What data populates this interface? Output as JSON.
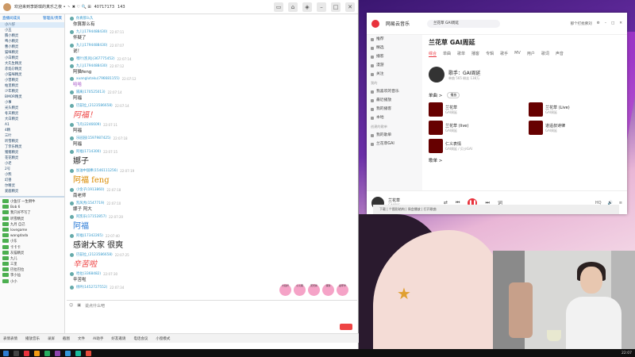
{
  "chat": {
    "title_bar": "欢迎来到李斯琪的真乐之夜 • 丶 ✖ ♡ 🔍 ⊞",
    "stat1": "40717173",
    "stat2": "143",
    "left_panel": {
      "title": "直播间成员",
      "right": "管理员/贵宾",
      "items": [
        "小八仔",
        "小五",
        "腾小精灵",
        "啤小精灵",
        "曹小精灵",
        "猫咪精灵",
        "小白精灵",
        "大先生精灵",
        "赤焰尕精灵",
        "小猫咪精灵",
        "小曾精灵",
        "帕里精灵",
        "少年精灵",
        "BMOR精灵",
        "小事",
        "光头精灵",
        "冬天精灵",
        "大白精灵",
        "A1",
        "4精",
        "三叶",
        "听雪精灵",
        "丁李乐精灵",
        "猪猪精灵",
        "花花精灵",
        "小老",
        "2号",
        "小熊",
        "幻兽",
        "尔精灵",
        "爱鹿精灵"
      ],
      "members": [
        "小鱼仔 一生倒牛",
        "Bob 6",
        "我只好不写了",
        "听雪精灵",
        "九月 自己",
        "lovegame",
        "wangdada",
        "小东",
        "卡卡卡",
        "灰猫精灵",
        "九儿",
        "三里",
        "巴拉巴拉",
        "李小仙",
        "小小"
      ]
    },
    "messages": [
      {
        "name": "你真那么久",
        "time": "",
        "text": "你算那么有",
        "cls": ""
      },
      {
        "name": "九儿(1794488430)",
        "time": "22:07:11",
        "text": "怀疑了",
        "cls": ""
      },
      {
        "name": "九儿(1794488430)",
        "time": "22:07:07",
        "text": "说！",
        "cls": ""
      },
      {
        "name": "嘿叶(凯风)(367775452)",
        "time": "22:07:14",
        "text": "",
        "cls": ""
      },
      {
        "name": "九儿(1794488430)",
        "time": "22:07:12",
        "text": "阿猫feng",
        "cls": ""
      },
      {
        "name": "xuanglutaku(796681155)",
        "time": "22:07:12",
        "text": "哈哈",
        "cls": "pur"
      },
      {
        "name": "隔离(170525013)",
        "time": "22:07:14",
        "text": "阿福",
        "cls": ""
      },
      {
        "name": "巴兹拉_(2123586658)",
        "time": "22:07:14",
        "text": "阿福！",
        "cls": "big red"
      },
      {
        "name": "飞鸟(2246609)",
        "time": "22:07:11",
        "text": "阿福",
        "cls": ""
      },
      {
        "name": "乐园园(1597987425)",
        "time": "22:07:18",
        "text": "阿福",
        "cls": ""
      },
      {
        "name": "阿福(1714300)",
        "time": "22:07:15",
        "text": "娜子",
        "cls": "big"
      },
      {
        "name": "加油中国棒(1546111256)",
        "time": "22:07:19",
        "text": "阿福 feng",
        "cls": "big org"
      },
      {
        "name": "小金子(1913860)",
        "time": "22:07:18",
        "text": "南老师",
        "cls": ""
      },
      {
        "name": "凯风秀(1547719)",
        "time": "22:07:10",
        "text": "娜子 阿大",
        "cls": ""
      },
      {
        "name": "阿凯乐(17152857)",
        "time": "22:07:20",
        "text": "阿福",
        "cls": "big blu"
      },
      {
        "name": "阿福(17342265)",
        "time": "22:07:40",
        "text": "感谢大家   很爽",
        "cls": "big"
      },
      {
        "name": "巴兹拉_(2123586658)",
        "time": "22:07:25",
        "text": "辛苦啦",
        "cls": "big red"
      },
      {
        "name": "哈拉(3368482)",
        "time": "22:07:30",
        "text": "辛苦啦",
        "cls": ""
      },
      {
        "name": "杨吟(1452727552)",
        "time": "22:07:34",
        "text": "",
        "cls": ""
      }
    ],
    "gifts": [
      "大拉杆",
      "小火箭",
      "荧光棒",
      "辣条",
      "嘉年华"
    ],
    "input_placeholder": "说点什么吧",
    "bottom": [
      "表情表情",
      "播放音乐",
      "录屏",
      "截图",
      "文件",
      "AI助手",
      "好友邀请",
      "电话会议",
      "小窗模式"
    ]
  },
  "music": {
    "brand": "网易云音乐",
    "search": "兰花草 GAI周延",
    "user": "那个打扰佛刘",
    "sidebar": [
      "推荐",
      "精选",
      "播客",
      "漫游",
      "关注",
      "我的",
      "我喜欢的音乐",
      "最近播放",
      "我的播客",
      "本地",
      "创建的歌单",
      "我的歌单",
      "兰花草GAI"
    ],
    "page_title": "兰花草 GAI周延",
    "tabs": [
      "综合",
      "单曲",
      "歌单",
      "播客",
      "专辑",
      "歌手",
      "MV",
      "用户",
      "歌词",
      "声音"
    ],
    "singer": {
      "name": "歌手：GAI周延",
      "stats": "单曲 565  粉丝 138万"
    },
    "songs_header": "单曲 >",
    "play_all": "播放",
    "songs": [
      {
        "name": "兰花草",
        "artist": "GAI周延"
      },
      {
        "name": "兰花草 (Live)",
        "artist": "GAI周延"
      },
      {
        "name": "兰花草 (live)",
        "artist": "GAI周延"
      },
      {
        "name": "道遥叔诗律",
        "artist": "GAI周延"
      },
      {
        "name": "仁义表情",
        "artist": "GAI周延 / 贝沙GAI"
      }
    ],
    "album": "歌单 >",
    "player": {
      "song": "兰花草",
      "artist": "GAI周延",
      "lyric": "下载 | 个图形结构 | 周会播放 | 打开歌曲"
    }
  },
  "taskbar": {
    "clock": "22:07"
  },
  "colors": {
    "accent": "#e8323c",
    "link": "#3399cc"
  }
}
